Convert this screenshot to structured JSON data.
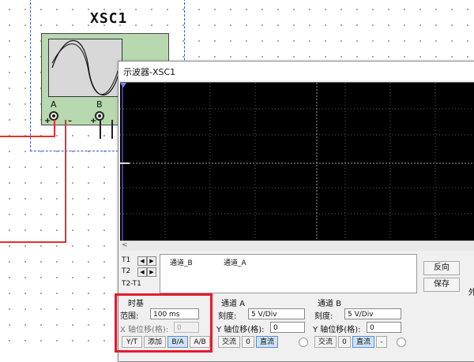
{
  "schematic": {
    "component_name": "XSC1",
    "terminal_a": "A",
    "terminal_b": "B",
    "plus": "+",
    "minus": "–"
  },
  "window": {
    "title": "示波器-XSC1"
  },
  "cursor": {
    "t1": "T1",
    "t2": "T2",
    "t2t1": "T2-T1",
    "left_arrow": "◀",
    "right_arrow": "▶"
  },
  "readout": {
    "channel_b": "通道_B",
    "channel_a": "通道_A"
  },
  "side": {
    "reverse_label": "反向",
    "save_label": "保存",
    "external_label": "外"
  },
  "timebase": {
    "title": "时基",
    "scale_label": "范围:",
    "scale_value": "100 ms",
    "x_pos_label": "X 轴位移(格):",
    "x_pos_value": "0",
    "buttons": [
      "Y/T",
      "添加",
      "B/A",
      "A/B"
    ]
  },
  "channel_a": {
    "title": "通道 A",
    "scale_label": "刻度:",
    "scale_value": "5 V/Div",
    "y_pos_label": "Y 轴位移(格):",
    "y_pos_value": "0",
    "ac": "交流",
    "zero": "0",
    "dc": "直流"
  },
  "channel_b": {
    "title": "通道 B",
    "scale_label": "刻度:",
    "scale_value": "5 V/Div",
    "y_pos_label": "Y 轴位移(格):",
    "y_pos_value": "0",
    "ac": "交流",
    "zero": "0",
    "dc": "直流",
    "minus": "-"
  },
  "colors": {
    "wire_red": "#e23030",
    "screen_bg": "#000000",
    "grid": "#6a6a6a",
    "highlight": "#e8192c"
  }
}
